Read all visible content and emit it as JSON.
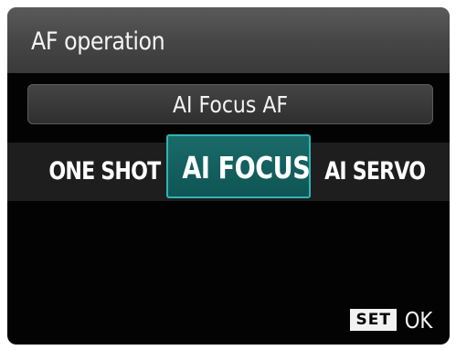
{
  "header": {
    "title": "AF operation"
  },
  "current_mode": {
    "label": "AI Focus AF"
  },
  "options": [
    {
      "label": "ONE SHOT",
      "selected": false
    },
    {
      "label": "AI FOCUS",
      "selected": true
    },
    {
      "label": "AI SERVO",
      "selected": false
    }
  ],
  "footer": {
    "set_badge": "SET",
    "ok_label": "OK"
  },
  "colors": {
    "selection_fill": "#136060",
    "selection_border": "#2fb5b5",
    "background": "#030303"
  }
}
